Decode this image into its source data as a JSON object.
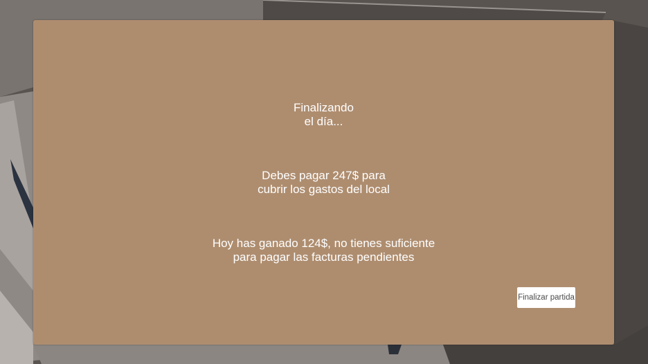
{
  "dialog": {
    "title_line1": "Finalizando",
    "title_line2": "el día...",
    "expenses_line1": "Debes pagar 247$ para",
    "expenses_line2": "cubrir los gastos del local",
    "earnings_line1": "Hoy has ganado 124$, no tienes suficiente",
    "earnings_line2": "para pagar las facturas pendientes",
    "end_button_label": "Finalizar partida"
  },
  "colors": {
    "panel": "#ae8d6f",
    "text": "#ffffff",
    "button": "#ffffff"
  }
}
